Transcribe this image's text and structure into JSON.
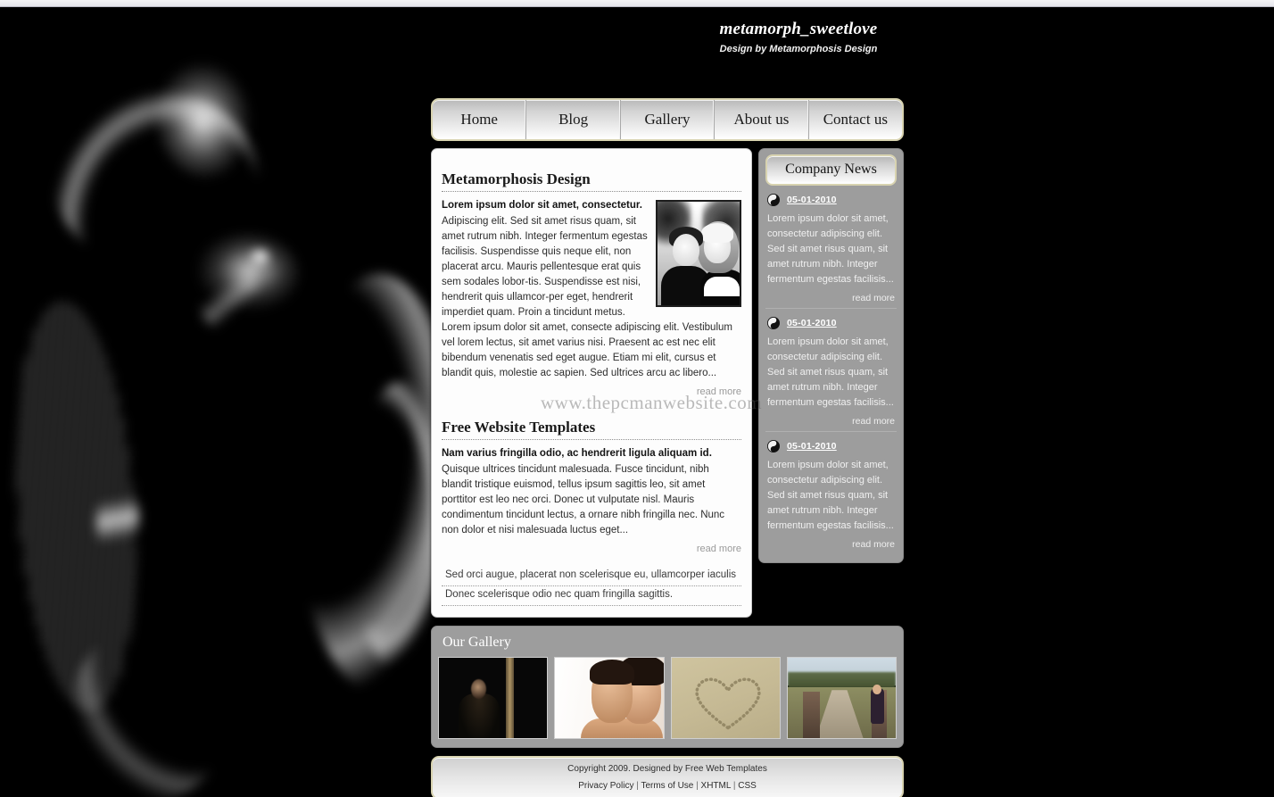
{
  "header": {
    "title": "metamorph_sweetlove",
    "tagline": "Design by Metamorphosis Design"
  },
  "nav": {
    "items": [
      {
        "label": "Home"
      },
      {
        "label": "Blog"
      },
      {
        "label": "Gallery"
      },
      {
        "label": "About us"
      },
      {
        "label": "Contact us"
      }
    ]
  },
  "watermark": "www.thepcmanwebsite.com",
  "content": {
    "posts": [
      {
        "title": "Metamorphosis Design",
        "lead": "Lorem ipsum dolor sit amet, consectetur.",
        "body": "Adipiscing elit. Sed sit amet risus quam, sit amet rutrum nibh. Integer fermentum egestas facilisis. Suspendisse quis neque elit, non placerat arcu. Mauris pellentesque erat quis sem sodales lobor-tis. Suspendisse est nisi, hendrerit quis ullamcor-per eget, hendrerit imperdiet quam. Proin a tincidunt metus. Lorem ipsum dolor sit amet, consecte adipiscing elit. Vestibulum vel lorem lectus, sit amet varius nisi. Praesent ac est nec elit bibendum venenatis sed eget augue. Etiam mi elit, cursus et blandit quis, molestie ac sapien. Sed ultrices arcu ac libero...",
        "read_more": "read more",
        "image_alt": "couple-photo"
      },
      {
        "title": "Free Website Templates",
        "lead": "Nam varius fringilla odio, ac hendrerit ligula aliquam id.",
        "body": "Quisque ultrices tincidunt malesuada. Fusce tincidunt, nibh blandit tristique euismod, tellus ipsum sagittis leo, sit amet porttitor est leo nec orci. Donec ut vulputate nisl. Mauris condimentum tincidunt lectus, a ornare nibh fringilla nec. Nunc non dolor et nisi malesuada luctus eget...",
        "read_more": "read more"
      }
    ],
    "facts": [
      "Sed orci augue, placerat non scelerisque eu, ullamcorper iaculis",
      "Donec scelerisque odio nec quam fringilla sagittis."
    ]
  },
  "sidebar": {
    "title": "Company News",
    "items": [
      {
        "icon": "yin-yang-icon",
        "date": "05-01-2010",
        "text": "Lorem ipsum dolor sit amet, consectetur adipiscing elit. Sed sit amet risus quam, sit amet rutrum nibh. Integer fermentum egestas facilisis...",
        "read_more": "read more"
      },
      {
        "icon": "yin-yang-icon",
        "date": "05-01-2010",
        "text": "Lorem ipsum dolor sit amet, consectetur adipiscing elit. Sed sit amet risus quam, sit amet rutrum nibh. Integer fermentum egestas facilisis...",
        "read_more": "read more"
      },
      {
        "icon": "yin-yang-icon",
        "date": "05-01-2010",
        "text": "Lorem ipsum dolor sit amet, consectetur adipiscing elit. Sed sit amet risus quam, sit amet rutrum nibh. Integer fermentum egestas facilisis...",
        "read_more": "read more"
      }
    ]
  },
  "gallery": {
    "title": "Our Gallery",
    "thumbs": [
      {
        "alt": "man-in-dark-doorway"
      },
      {
        "alt": "couple-embracing-closeup"
      },
      {
        "alt": "heart-drawn-in-sand"
      },
      {
        "alt": "woman-on-wooden-bridge"
      }
    ]
  },
  "footer": {
    "copyright": "Copyright 2009. Designed by Free Web Templates",
    "links": [
      {
        "label": "Privacy Policy"
      },
      {
        "label": "Terms of Use"
      },
      {
        "label": "XHTML"
      },
      {
        "label": "CSS"
      }
    ],
    "separator": "|"
  },
  "colors": {
    "page_background": "#000000",
    "nav_border": "#d8d3b0",
    "panel_background": "#fdfdfd",
    "sidebar_background": "#9d9d9d",
    "link_muted": "#9a9a9a"
  }
}
